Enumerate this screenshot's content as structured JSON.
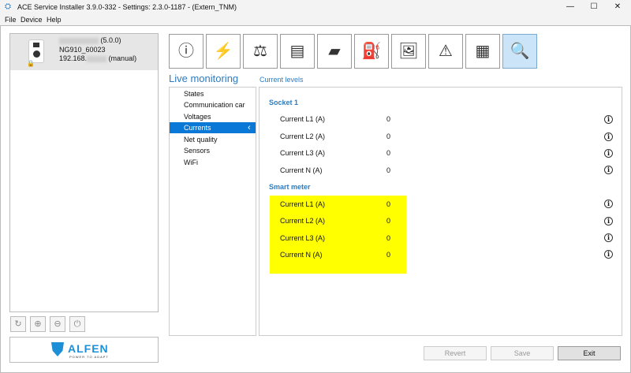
{
  "window": {
    "title": "ACE Service Installer 3.9.0-332 - Settings: 2.3.0-1187 -  (Extern_TNM)"
  },
  "menu": [
    "File",
    "Device",
    "Help"
  ],
  "device": {
    "version": "(5.0.0)",
    "model": "NG910_60023",
    "ip_prefix": "192.168.",
    "ip_mode": "(manual)"
  },
  "logo": {
    "name": "ALFEN",
    "tagline": "POWER TO ADAPT"
  },
  "toolbar": [
    {
      "icon": "info-icon"
    },
    {
      "icon": "pylon-icon"
    },
    {
      "icon": "balance-icon"
    },
    {
      "icon": "cards-icon"
    },
    {
      "icon": "payment-terminal-icon"
    },
    {
      "icon": "charger-signal-icon"
    },
    {
      "icon": "display-icon"
    },
    {
      "icon": "warning-icon"
    },
    {
      "icon": "document-icon"
    },
    {
      "icon": "monitor-search-icon",
      "active": true
    }
  ],
  "section_title": "Live monitoring",
  "subtitle": "Current levels",
  "nav": [
    "States",
    "Communication car",
    "Voltages",
    "Currents",
    "Net quality",
    "Sensors",
    "WiFi"
  ],
  "selected_nav": "Currents",
  "socket": {
    "title": "Socket 1",
    "rows": [
      {
        "label": "Current L1 (A)",
        "value": "0"
      },
      {
        "label": "Current L2 (A)",
        "value": "0"
      },
      {
        "label": "Current L3 (A)",
        "value": "0"
      },
      {
        "label": "Current N (A)",
        "value": "0"
      }
    ]
  },
  "meter": {
    "title": "Smart meter",
    "rows": [
      {
        "label": "Current L1 (A)",
        "value": "0"
      },
      {
        "label": "Current L2 (A)",
        "value": "0"
      },
      {
        "label": "Current L3 (A)",
        "value": "0"
      },
      {
        "label": "Current N (A)",
        "value": "0"
      }
    ]
  },
  "buttons": {
    "revert": "Revert",
    "save": "Save",
    "exit": "Exit"
  },
  "highlight_color": "#ffff00"
}
